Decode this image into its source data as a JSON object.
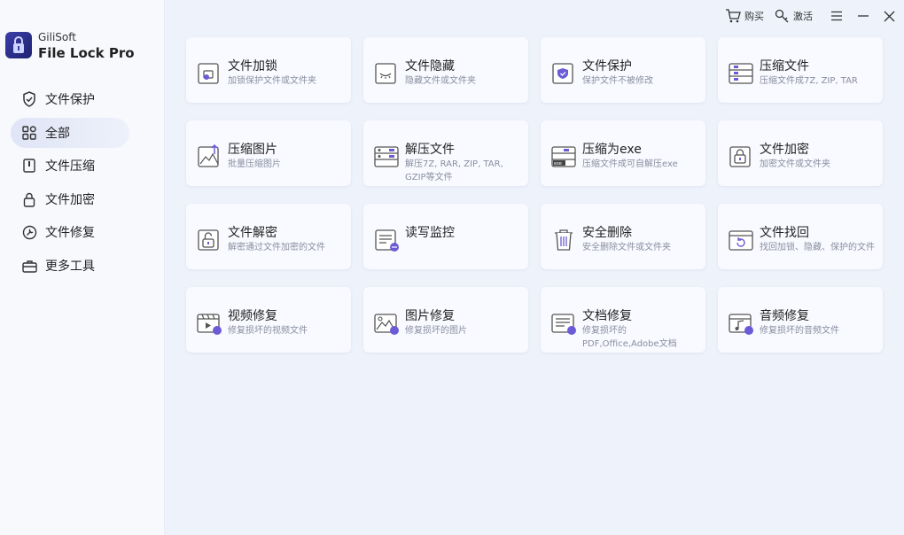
{
  "app": {
    "brand_small": "GiliSoft",
    "brand_big": "File Lock Pro"
  },
  "topbar": {
    "buy": "购买",
    "activate": "激活"
  },
  "sidebar": {
    "items": [
      {
        "label": "文件保护",
        "icon": "shield-icon"
      },
      {
        "label": "全部",
        "icon": "grid-icon"
      },
      {
        "label": "文件压缩",
        "icon": "archive-icon"
      },
      {
        "label": "文件加密",
        "icon": "lock-icon"
      },
      {
        "label": "文件修复",
        "icon": "repair-icon"
      },
      {
        "label": "更多工具",
        "icon": "toolbox-icon"
      }
    ]
  },
  "cards": [
    {
      "title": "文件加锁",
      "desc": "加锁保护文件或文件夹",
      "icon": "file-lock-icon"
    },
    {
      "title": "文件隐藏",
      "desc": "隐藏文件或文件夹",
      "icon": "file-hide-icon"
    },
    {
      "title": "文件保护",
      "desc": "保护文件不被修改",
      "icon": "file-protect-icon"
    },
    {
      "title": "压缩文件",
      "desc": "压缩文件成7Z, ZIP, TAR",
      "icon": "compress-file-icon"
    },
    {
      "title": "压缩图片",
      "desc": "批量压缩图片",
      "icon": "compress-image-icon"
    },
    {
      "title": "解压文件",
      "desc": "解压7Z, RAR, ZIP, TAR, GZIP等文件",
      "icon": "extract-file-icon"
    },
    {
      "title": "压缩为exe",
      "desc": "压缩文件成可自解压exe",
      "icon": "compress-exe-icon"
    },
    {
      "title": "文件加密",
      "desc": "加密文件或文件夹",
      "icon": "file-encrypt-icon"
    },
    {
      "title": "文件解密",
      "desc": "解密通过文件加密的文件",
      "icon": "file-decrypt-icon"
    },
    {
      "title": "读写监控",
      "desc": "",
      "icon": "rw-monitor-icon"
    },
    {
      "title": "安全删除",
      "desc": "安全删除文件或文件夹",
      "icon": "secure-delete-icon"
    },
    {
      "title": "文件找回",
      "desc": "找回加锁、隐藏、保护的文件",
      "icon": "file-recover-icon"
    },
    {
      "title": "视频修复",
      "desc": "修复损坏的视频文件",
      "icon": "video-repair-icon"
    },
    {
      "title": "图片修复",
      "desc": "修复损坏的图片",
      "icon": "image-repair-icon"
    },
    {
      "title": "文档修复",
      "desc": "修复损坏的PDF,Office,Adobe文档",
      "icon": "doc-repair-icon"
    },
    {
      "title": "音频修复",
      "desc": "修复损坏的音频文件",
      "icon": "audio-repair-icon"
    }
  ],
  "colors": {
    "accent": "#6b5bd6",
    "card_bg": "#f8faff",
    "sidebar_bg": "#f7f9fd",
    "main_bg": "#eef2fb"
  }
}
